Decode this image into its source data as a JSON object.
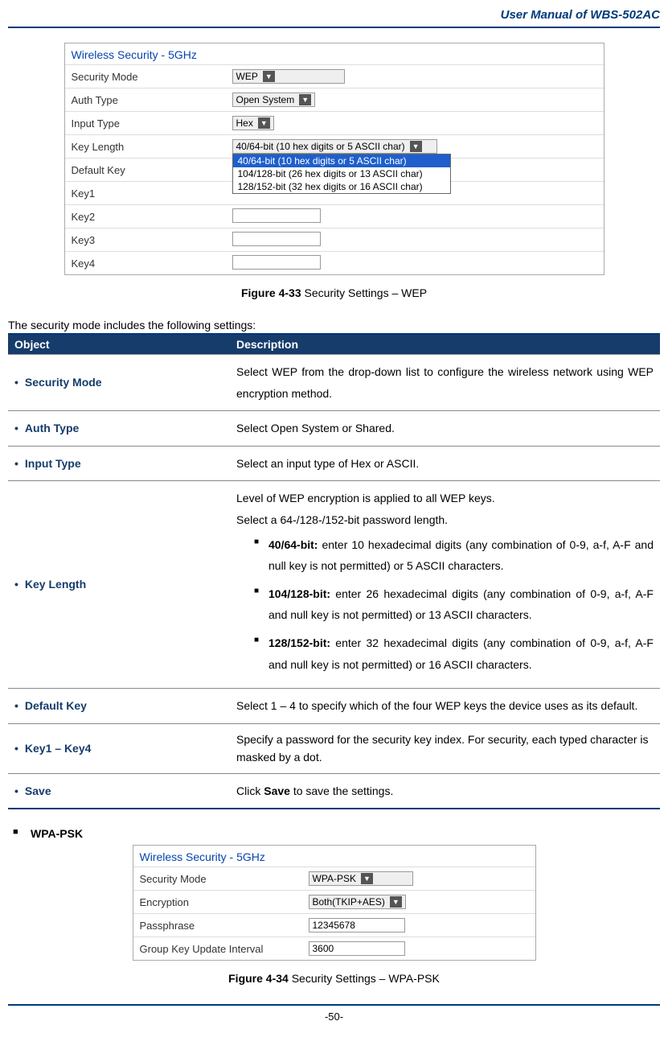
{
  "header": {
    "title": "User Manual of WBS-502AC"
  },
  "figure1": {
    "title": "Wireless Security - 5GHz",
    "rows": {
      "security_mode": {
        "label": "Security Mode",
        "value": "WEP"
      },
      "auth_type": {
        "label": "Auth Type",
        "value": "Open System"
      },
      "input_type": {
        "label": "Input Type",
        "value": "Hex"
      },
      "key_length": {
        "label": "Key Length",
        "value": "40/64-bit (10 hex digits or 5 ASCII char)",
        "options": [
          "40/64-bit (10 hex digits or 5 ASCII char)",
          "104/128-bit (26 hex digits or 13 ASCII char)",
          "128/152-bit (32 hex digits or 16 ASCII char)"
        ]
      },
      "default_key": {
        "label": "Default Key"
      },
      "key1": {
        "label": "Key1"
      },
      "key2": {
        "label": "Key2"
      },
      "key3": {
        "label": "Key3"
      },
      "key4": {
        "label": "Key4"
      }
    },
    "caption_label": "Figure 4-33",
    "caption_text": " Security Settings – WEP"
  },
  "intro": "The security mode includes the following settings:",
  "table": {
    "head_object": "Object",
    "head_desc": "Description",
    "rows": {
      "security_mode": {
        "obj": "Security Mode",
        "desc": "Select WEP from the drop-down list to configure the wireless network using WEP encryption method."
      },
      "auth_type": {
        "obj": "Auth Type",
        "desc": "Select Open System or Shared."
      },
      "input_type": {
        "obj": "Input Type",
        "desc": "Select an input type of Hex or ASCII."
      },
      "key_length": {
        "obj": "Key Length",
        "intro1": "Level of WEP encryption is applied to all WEP keys.",
        "intro2": "Select a 64-/128-/152-bit password length.",
        "b1_label": "40/64-bit:",
        "b1_text": " enter 10 hexadecimal digits (any combination of 0-9, a-f, A-F and null key is not permitted) or 5 ASCII characters.",
        "b2_label": "104/128-bit:",
        "b2_text": " enter 26 hexadecimal digits (any combination of 0-9, a-f, A-F and null key is not permitted) or 13 ASCII characters.",
        "b3_label": "128/152-bit:",
        "b3_text": " enter 32 hexadecimal digits (any combination of 0-9, a-f, A-F and null key is not permitted) or 16 ASCII characters."
      },
      "default_key": {
        "obj": "Default Key",
        "desc": "Select 1 – 4 to specify which of the four WEP keys the device uses as its default."
      },
      "key1_4": {
        "obj": "Key1 – Key4",
        "desc": "Specify a password for the security key index. For security, each typed character is masked by a dot."
      },
      "save": {
        "obj": "Save",
        "desc_pre": "Click ",
        "desc_bold": "Save",
        "desc_post": " to save the settings."
      }
    }
  },
  "section2": {
    "heading": "WPA-PSK",
    "panel_title": "Wireless Security - 5GHz",
    "rows": {
      "security_mode": {
        "label": "Security Mode",
        "value": "WPA-PSK"
      },
      "encryption": {
        "label": "Encryption",
        "value": "Both(TKIP+AES)"
      },
      "passphrase": {
        "label": "Passphrase",
        "value": "12345678"
      },
      "gkui": {
        "label": "Group Key Update Interval",
        "value": "3600"
      }
    },
    "caption_label": "Figure 4-34",
    "caption_text": " Security Settings – WPA-PSK"
  },
  "footer": {
    "page": "-50-"
  }
}
